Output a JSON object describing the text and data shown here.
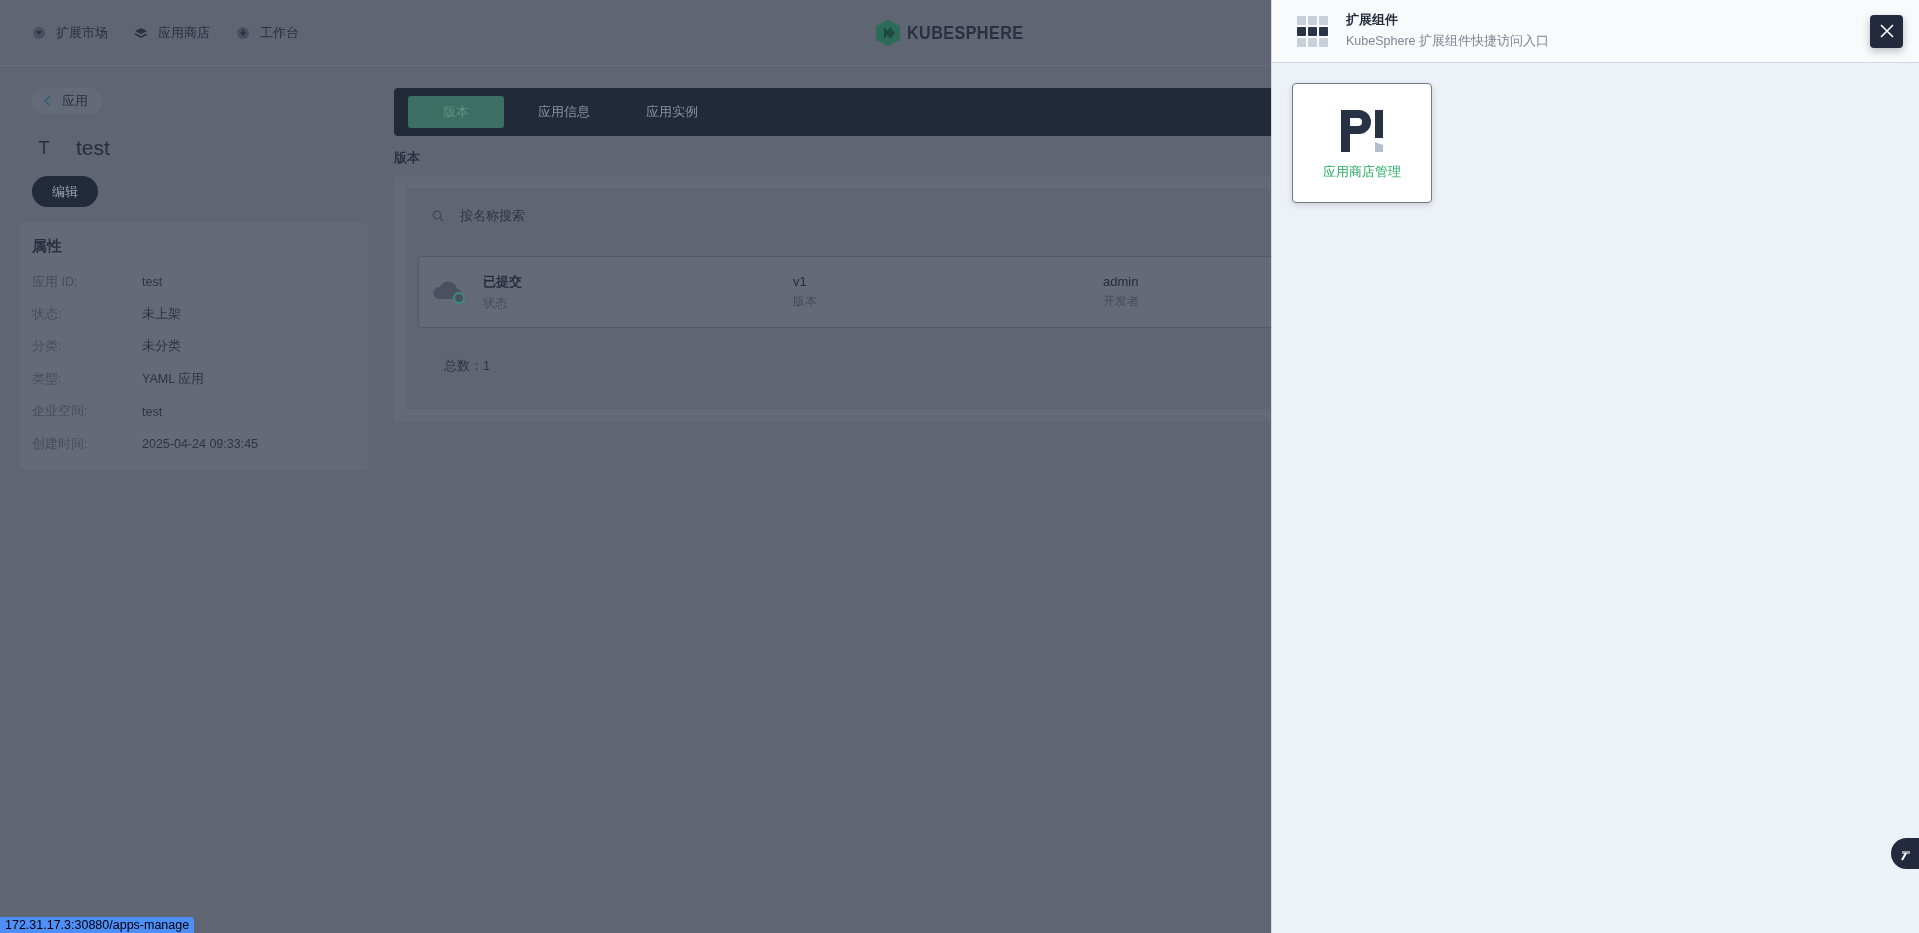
{
  "top_nav": {
    "links": [
      {
        "label": "扩展市场"
      },
      {
        "label": "应用商店"
      },
      {
        "label": "工作台"
      }
    ],
    "logo_text": "KUBESPHERE"
  },
  "back_link": "应用",
  "app": {
    "avatar_letter": "T",
    "name": "test",
    "edit_button": "编辑"
  },
  "properties": {
    "title": "属性",
    "rows": [
      {
        "label": "应用 ID:",
        "value": "test"
      },
      {
        "label": "状态:",
        "value": "未上架"
      },
      {
        "label": "分类:",
        "value": "未分类"
      },
      {
        "label": "类型:",
        "value": "YAML 应用"
      },
      {
        "label": "企业空间:",
        "value": "test"
      },
      {
        "label": "创建时间:",
        "value": "2025-04-24 09:33:45"
      }
    ]
  },
  "tabs": [
    {
      "label": "版本",
      "selected": true
    },
    {
      "label": "应用信息",
      "selected": false
    },
    {
      "label": "应用实例",
      "selected": false
    }
  ],
  "section_title": "版本",
  "search": {
    "placeholder": "按名称搜索"
  },
  "versions": [
    {
      "status": "已提交",
      "status_label": "状态",
      "version": "v1",
      "version_label": "版本",
      "developer": "admin",
      "developer_label": "开发者"
    }
  ],
  "total": "总数：1",
  "drawer": {
    "title": "扩展组件",
    "subtitle": "KubeSphere 扩展组件快捷访问入口",
    "extensions": [
      {
        "name": "应用商店管理"
      }
    ]
  },
  "status_url": "172.31.17.3:30880/apps-manage"
}
